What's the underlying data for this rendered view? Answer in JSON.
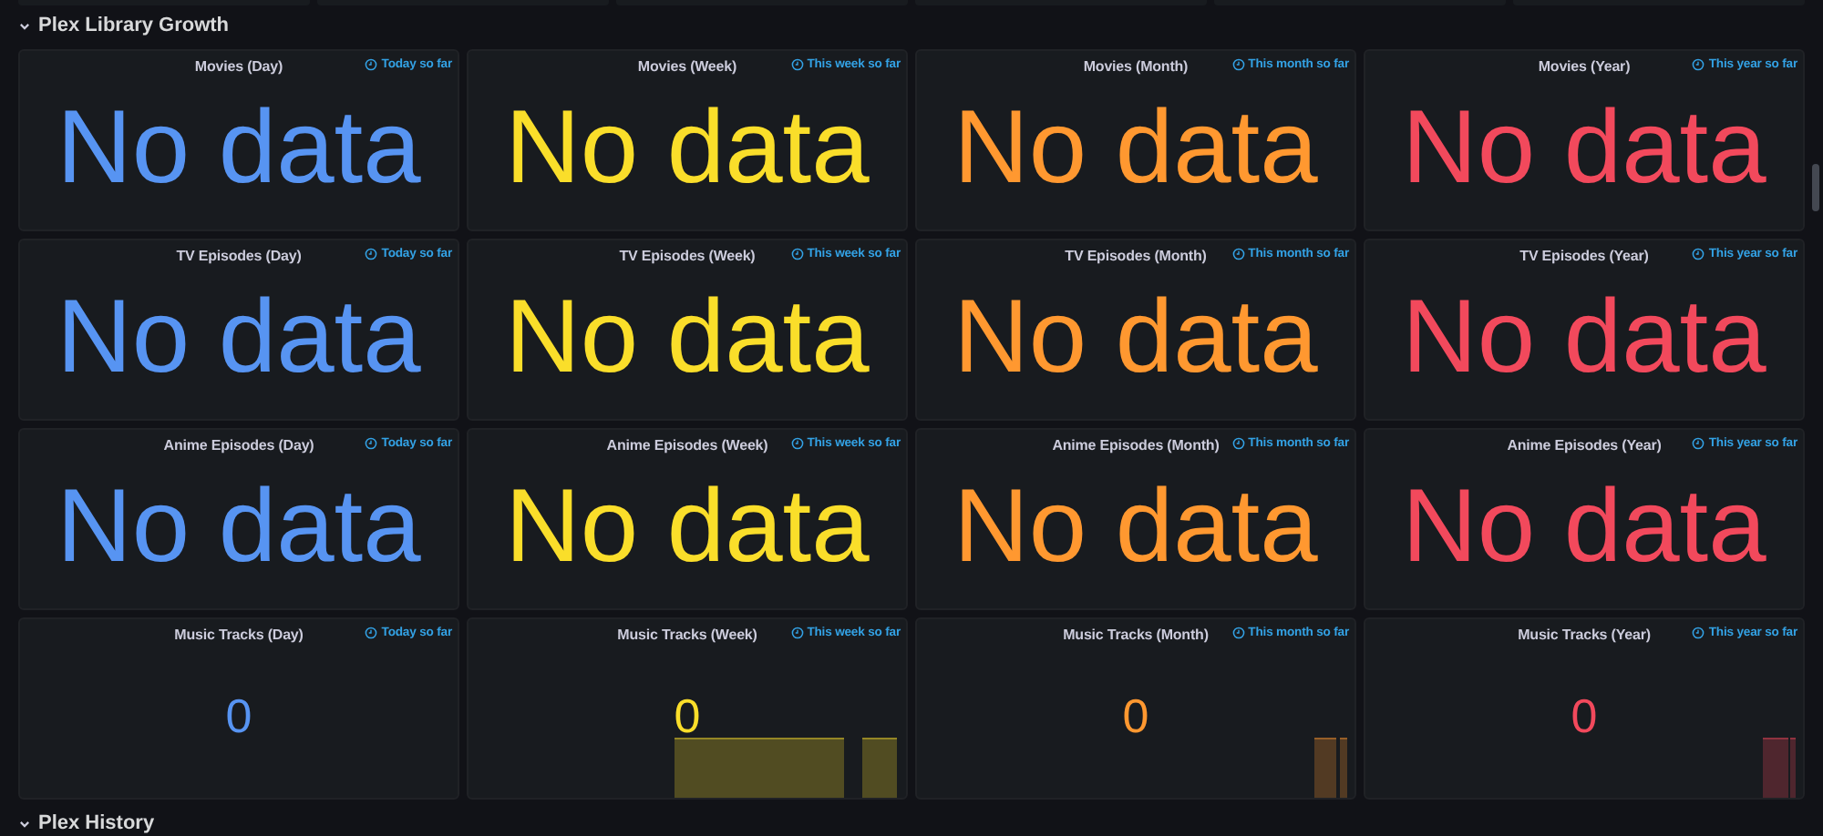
{
  "sections": [
    {
      "title": "Plex Library Growth",
      "expanded": true,
      "panels": [
        {
          "title": "Movies (Day)",
          "range": "Today so far",
          "value": "No data",
          "color": "#5794f2",
          "sparkline": false
        },
        {
          "title": "Movies (Week)",
          "range": "This week so far",
          "value": "No data",
          "color": "#fade2a",
          "sparkline": false
        },
        {
          "title": "Movies (Month)",
          "range": "This month so far",
          "value": "No data",
          "color": "#ff9830",
          "sparkline": false
        },
        {
          "title": "Movies (Year)",
          "range": "This year so far",
          "value": "No data",
          "color": "#f2495c",
          "sparkline": false
        },
        {
          "title": "TV Episodes (Day)",
          "range": "Today so far",
          "value": "No data",
          "color": "#5794f2",
          "sparkline": false
        },
        {
          "title": "TV Episodes (Week)",
          "range": "This week so far",
          "value": "No data",
          "color": "#fade2a",
          "sparkline": false
        },
        {
          "title": "TV Episodes (Month)",
          "range": "This month so far",
          "value": "No data",
          "color": "#ff9830",
          "sparkline": false
        },
        {
          "title": "TV Episodes (Year)",
          "range": "This year so far",
          "value": "No data",
          "color": "#f2495c",
          "sparkline": false
        },
        {
          "title": "Anime Episodes (Day)",
          "range": "Today so far",
          "value": "No data",
          "color": "#5794f2",
          "sparkline": false
        },
        {
          "title": "Anime Episodes (Week)",
          "range": "This week so far",
          "value": "No data",
          "color": "#fade2a",
          "sparkline": false
        },
        {
          "title": "Anime Episodes (Month)",
          "range": "This month so far",
          "value": "No data",
          "color": "#ff9830",
          "sparkline": false
        },
        {
          "title": "Anime Episodes (Year)",
          "range": "This year so far",
          "value": "No data",
          "color": "#f2495c",
          "sparkline": false
        },
        {
          "title": "Music Tracks (Day)",
          "range": "Today so far",
          "value": "0",
          "color": "#5794f2",
          "sparkline": false
        },
        {
          "title": "Music Tracks (Week)",
          "range": "This week so far",
          "value": "0",
          "color": "#fade2a",
          "sparkline": true
        },
        {
          "title": "Music Tracks (Month)",
          "range": "This month so far",
          "value": "0",
          "color": "#ff9830",
          "sparkline": true
        },
        {
          "title": "Music Tracks (Year)",
          "range": "This year so far",
          "value": "0",
          "color": "#f2495c",
          "sparkline": true
        }
      ]
    },
    {
      "title": "Plex History",
      "expanded": true
    }
  ]
}
